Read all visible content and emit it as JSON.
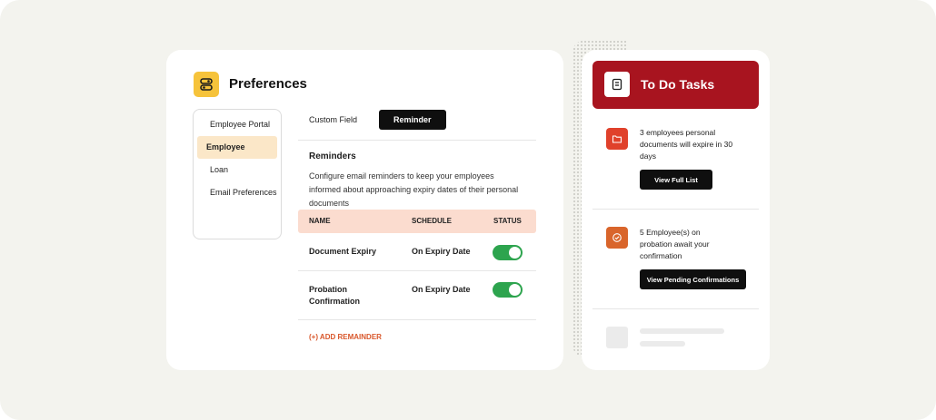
{
  "preferences": {
    "title": "Preferences",
    "nav": [
      "Employee Portal",
      "Employee",
      "Loan",
      "Email Preferences"
    ],
    "tabs": [
      "Custom Field",
      "Reminder"
    ],
    "section_title": "Reminders",
    "section_desc": "Configure email reminders to keep your employees informed about approaching expiry dates of their personal documents",
    "table": {
      "headers": [
        "NAME",
        "SCHEDULE",
        "STATUS"
      ],
      "rows": [
        {
          "name": "Document Expiry",
          "schedule": "On Expiry Date",
          "status_on": true
        },
        {
          "name": "Probation Confirmation",
          "schedule": "On Expiry Date",
          "status_on": true
        }
      ]
    },
    "add_label": "(+) ADD REMAINDER"
  },
  "todo": {
    "title": "To Do Tasks",
    "tasks": [
      {
        "text": "3 employees personal documents will expire in 30 days",
        "button": "View Full List",
        "icon": "folder-icon",
        "color": "#e0412b"
      },
      {
        "text": "5 Employee(s) on probation await your confirmation",
        "button": "View Pending Confirmations",
        "icon": "check-circle-icon",
        "color": "#d9652b"
      }
    ]
  },
  "colors": {
    "accent_yellow": "#f6c33b",
    "todo_header": "#a8141f",
    "table_header": "#fbdccf",
    "toggle_on": "#2da44e",
    "link_orange": "#d9572b"
  }
}
